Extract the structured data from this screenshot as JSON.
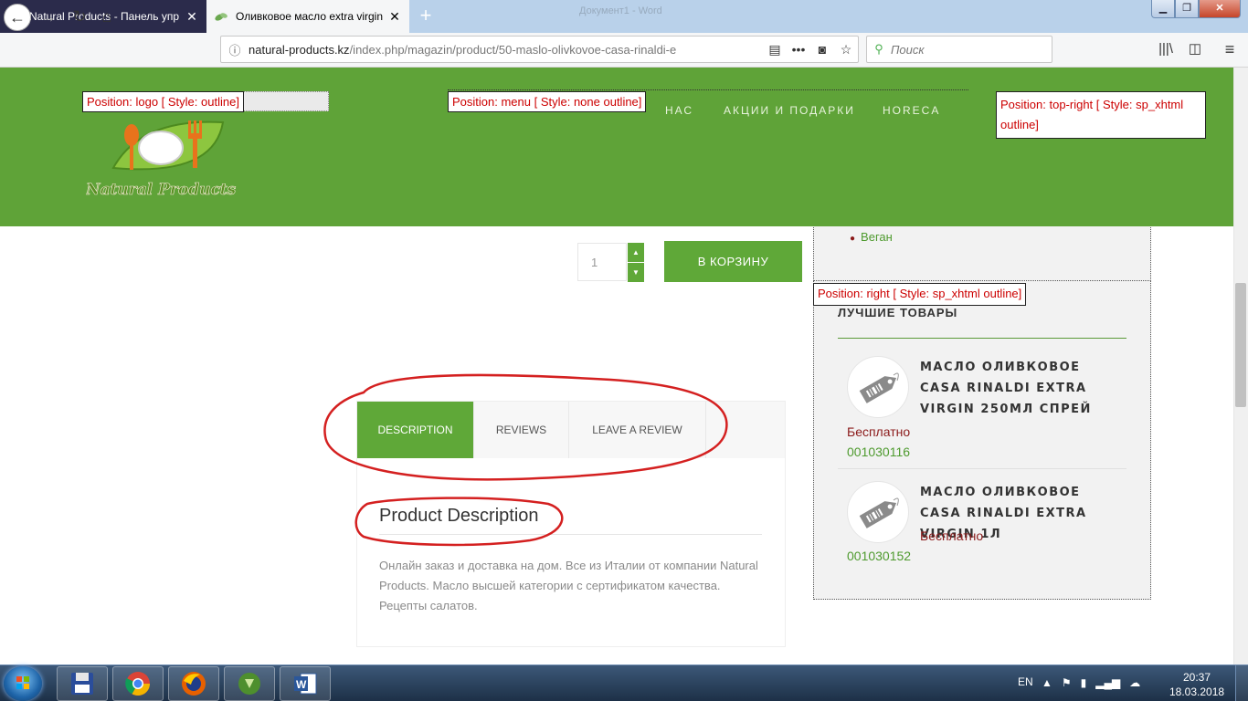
{
  "browser": {
    "tabs": [
      {
        "title": "Natural Products - Панель упр",
        "icon": "joomla-icon"
      },
      {
        "title": "Оливковое масло extra virgin",
        "icon": "leaf-icon"
      }
    ],
    "window_title": "Документ1 - Word",
    "url_host": "natural-products.kz",
    "url_path": "/index.php/magazin/product/50-maslo-olivkovoe-casa-rinaldi-e",
    "search_placeholder": "Поиск",
    "new_tab_symbol": "+"
  },
  "header": {
    "bg_color": "#5fa338",
    "logo_text": "Natural Products",
    "pos_logo": "Position: logo [ Style: outline]",
    "pos_menu": "Position: menu [ Style: none outline]",
    "pos_topright": "Position: top-right [ Style: sp_xhtml outline]",
    "menu": [
      "НАС",
      "АКЦИИ И ПОДАРКИ",
      "HORECA"
    ]
  },
  "product": {
    "quantity": "1",
    "add_to_cart": "В КОРЗИНУ",
    "tabs": [
      "DESCRIPTION",
      "REVIEWS",
      "LEAVE A REVIEW"
    ],
    "active_tab": "DESCRIPTION",
    "desc_title": "Product Description",
    "desc_text": "Онлайн заказ и доставка на дом. Все из Италии от компании Natural Products. Масло высшей категории с сертификатом качества. Рецепты салатов."
  },
  "sidebar": {
    "category_item": "Веган",
    "pos_right": "Position: right [ Style: sp_xhtml outline]",
    "best_title": "ЛУЧШИЕ ТОВАРЫ",
    "products": [
      {
        "name": "МАСЛО ОЛИВКОВОЕ CASA RINALDI EXTRA VIRGIN 250МЛ СПРЕЙ",
        "price": "Бесплатно",
        "sku": "001030116"
      },
      {
        "name": "МАСЛО ОЛИВКОВОЕ CASA RINALDI EXTRA VIRGIN 1Л",
        "price": "Бесплатно",
        "sku": "001030152"
      }
    ]
  },
  "taskbar": {
    "lang": "EN",
    "time": "20:37",
    "date": "18.03.2018",
    "apps": [
      "save-floppy-icon",
      "chrome-icon",
      "firefox-icon",
      "installer-icon",
      "word-icon"
    ]
  },
  "colors": {
    "accent": "#5fa838",
    "annotation": "#d42020",
    "price": "#8b1a1a"
  }
}
